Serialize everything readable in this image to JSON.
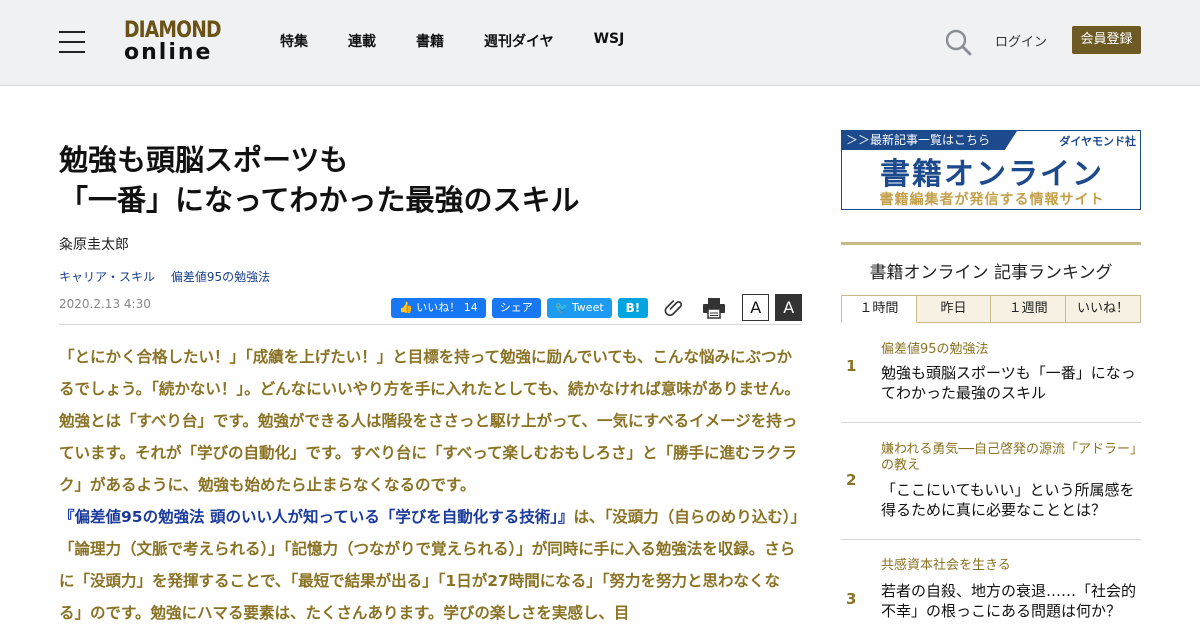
{
  "header": {
    "logo_line1": "DIAMOND",
    "logo_line2": "online",
    "nav": [
      "特集",
      "連載",
      "書籍",
      "週刊ダイヤ",
      "WSJ"
    ],
    "login": "ログイン",
    "register": "会員登録"
  },
  "article": {
    "title_line1": "勉強も頭脳スポーツも",
    "title_line2": "「一番」になってわかった最強のスキル",
    "author": "粂原圭太郎",
    "tags": [
      "キャリア・スキル",
      "偏差値95の勉強法"
    ],
    "date": "2020.2.13 4:30",
    "share": {
      "like": "いいね！ 14",
      "fb_share": "シェア",
      "tweet": "Tweet",
      "hatena": "B!"
    },
    "font_small": "A",
    "font_large": "A",
    "body_p1": "「とにかく合格したい！」「成績を上げたい！」と目標を持って勉強に励んでいても、こんな悩みにぶつかるでしょう。「続かない！」。どんなにいいやり方を手に入れたとしても、続かなければ意味がありません。勉強とは「すべり台」です。勉強ができる人は階段をささっと駆け上がって、一気にすべるイメージを持っています。それが「学びの自動化」です。すべり台に「すべって楽しむおもしろさ」と「勝手に進むラクラク」があるように、勉強も始めたら止まらなくなるのです。",
    "body_book": "『偏差値95の勉強法 頭のいい人が知っている「学びを自動化する技術」』",
    "body_p2": "は、「没頭力（自らのめり込む）」「論理力（文脈で考えられる）」「記憶力（つながりで覚えられる）」が同時に手に入る勉強法を収録。さらに「没頭力」を発揮することで、「最短で結果が出る」「1日が27時間になる」「努力を努力と思わなくなる」のです。勉強にハマる要素は、たくさんあります。学びの楽しさを実感し、目"
  },
  "sidebar": {
    "banner": {
      "top_left": "＞＞最新記事一覧はこちら",
      "top_right": "ダイヤモンド社",
      "title": "書籍オンライン",
      "subtitle": "書籍編集者が発信する情報サイト"
    },
    "ranking": {
      "title": "書籍オンライン 記事ランキング",
      "tabs": [
        "１時間",
        "昨日",
        "１週間",
        "いいね！"
      ],
      "items": [
        {
          "rank": "1",
          "category": "偏差値95の勉強法",
          "text": "勉強も頭脳スポーツも「一番」になってわかった最強のスキル"
        },
        {
          "rank": "2",
          "category": "嫌われる勇気──自己啓発の源流「アドラー」の教え",
          "text": "「ここにいてもいい」という所属感を得るために真に必要なこととは？"
        },
        {
          "rank": "3",
          "category": "共感資本社会を生きる",
          "text": "若者の自殺、地方の衰退……「社会的不幸」の根っこにある問題は何か？"
        }
      ]
    }
  },
  "colors": {
    "accent": "#6d5a25",
    "body_text": "#8a7324",
    "link": "#1a3a9c"
  }
}
